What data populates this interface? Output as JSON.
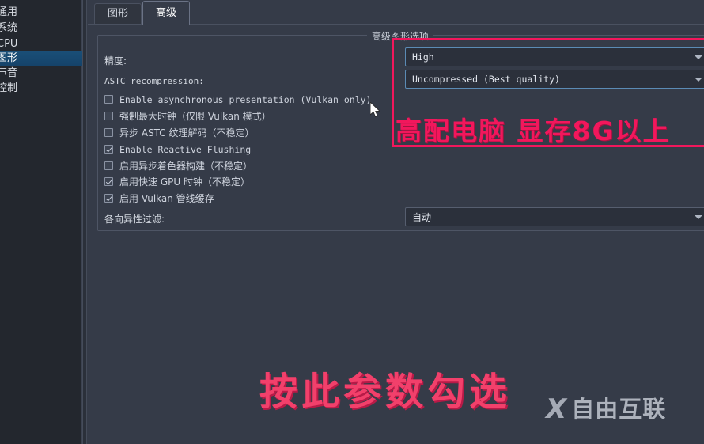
{
  "sidebar": {
    "items": [
      {
        "label": "通用",
        "selected": false
      },
      {
        "label": "系统",
        "selected": false
      },
      {
        "label": "CPU",
        "selected": false
      },
      {
        "label": "图形",
        "selected": true
      },
      {
        "label": "声音",
        "selected": false
      },
      {
        "label": "控制",
        "selected": false
      }
    ]
  },
  "tabs": [
    {
      "label": "图形",
      "active": false
    },
    {
      "label": "高级",
      "active": true
    }
  ],
  "groupbox": {
    "title": "高级图形选项"
  },
  "form": {
    "accuracy_label": "精度:",
    "astc_label": "ASTC recompression:",
    "anisotropic_label": "各向异性过滤:"
  },
  "checkboxes": [
    {
      "label": "Enable asynchronous presentation (Vulkan only)",
      "checked": false,
      "lang": "en"
    },
    {
      "label": "强制最大时钟（仅限 Vulkan 模式）",
      "checked": false,
      "lang": "cn"
    },
    {
      "label": "异步 ASTC 纹理解码（不稳定）",
      "checked": false,
      "lang": "cn"
    },
    {
      "label": "Enable Reactive Flushing",
      "checked": true,
      "lang": "en"
    },
    {
      "label": "启用异步着色器构建（不稳定）",
      "checked": false,
      "lang": "cn"
    },
    {
      "label": "启用快速 GPU 时钟（不稳定）",
      "checked": true,
      "lang": "cn"
    },
    {
      "label": "启用 Vulkan 管线缓存",
      "checked": true,
      "lang": "cn"
    }
  ],
  "dropdowns": [
    {
      "name": "accuracy",
      "value": "High",
      "lang": "en"
    },
    {
      "name": "astc-recompression",
      "value": "Uncompressed (Best quality)",
      "lang": "en"
    },
    {
      "name": "anisotropic-filtering",
      "value": "自动",
      "lang": "cn"
    }
  ],
  "annotations": {
    "top_note": "高配电脑 显存8G以上",
    "bottom_note": "按此参数勾选",
    "highlight_color": "#f2175c"
  },
  "watermark": {
    "logo": "X",
    "text": "自由互联"
  },
  "colors": {
    "sidebar_bg": "#23272e",
    "panel_bg": "#353b48",
    "selection_blue": "#1a4f78",
    "pink": "#f2175c"
  }
}
